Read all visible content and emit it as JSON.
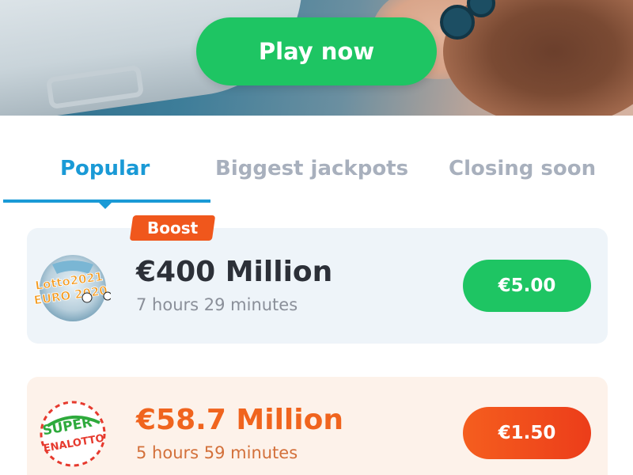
{
  "hero": {
    "play_label": "Play now"
  },
  "tabs": [
    {
      "label": "Popular",
      "active": true
    },
    {
      "label": "Biggest jackpots",
      "active": false
    },
    {
      "label": "Closing soon",
      "active": false
    }
  ],
  "colors": {
    "primary_green": "#1ec563",
    "active_tab_blue": "#1a9ad6",
    "boost_orange": "#f0571c",
    "superenalotto_orange": "#f0641e"
  },
  "lotteries": [
    {
      "logo": "lotto2021-euro2020-logo",
      "logo_lines": [
        "Lotto2021",
        "EURO 2020"
      ],
      "badge": "Boost",
      "jackpot": "€400 Million",
      "time_left": "7 hours 29 minutes",
      "price": "€5.00"
    },
    {
      "logo": "superenalotto-logo",
      "logo_lines": [
        "SUPER",
        "ENALOTTO"
      ],
      "jackpot": "€58.7 Million",
      "time_left": "5 hours 59 minutes",
      "price": "€1.50"
    }
  ]
}
